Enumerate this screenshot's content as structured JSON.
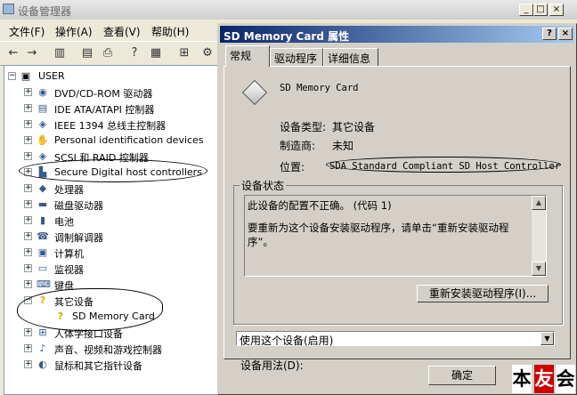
{
  "device_manager": {
    "title": "设备管理器",
    "menu": [
      "文件(F)",
      "操作(A)",
      "查看(V)",
      "帮助(H)"
    ],
    "root": "USER",
    "tree": [
      {
        "label": "DVD/CD-ROM 驱动器",
        "icon": "dvd-drive-icon",
        "glyph": "◉"
      },
      {
        "label": "IDE ATA/ATAPI 控制器",
        "icon": "ide-controller-icon",
        "glyph": "▤"
      },
      {
        "label": "IEEE 1394 总线主控制器",
        "icon": "ieee1394-icon",
        "glyph": "◈"
      },
      {
        "label": "Personal identification devices",
        "icon": "fingerprint-device-icon",
        "glyph": "✋"
      },
      {
        "label": "SCSI 和 RAID 控制器",
        "icon": "scsi-controller-icon",
        "glyph": "◈"
      },
      {
        "label": "Secure Digital host controllers",
        "icon": "sd-host-controller-icon",
        "glyph": "▙"
      },
      {
        "label": "处理器",
        "icon": "processor-icon",
        "glyph": "◆"
      },
      {
        "label": "磁盘驱动器",
        "icon": "disk-drive-icon",
        "glyph": "▬"
      },
      {
        "label": "电池",
        "icon": "battery-icon",
        "glyph": "▮"
      },
      {
        "label": "调制解调器",
        "icon": "modem-icon",
        "glyph": "☎"
      },
      {
        "label": "计算机",
        "icon": "computer-icon",
        "glyph": "▣"
      },
      {
        "label": "监视器",
        "icon": "monitor-icon",
        "glyph": "▭"
      },
      {
        "label": "键盘",
        "icon": "keyboard-icon",
        "glyph": "⌨"
      },
      {
        "label": "其它设备",
        "icon": "other-devices-icon",
        "glyph": "?"
      },
      {
        "label": "SD Memory Card",
        "icon": "warning-device-icon",
        "glyph": "?"
      },
      {
        "label": "人体学接口设备",
        "icon": "hid-icon",
        "glyph": "⊞"
      },
      {
        "label": "声音、视频和游戏控制器",
        "icon": "sound-controller-icon",
        "glyph": "♪"
      },
      {
        "label": "鼠标和其它指针设备",
        "icon": "mouse-icon",
        "glyph": "◐"
      }
    ]
  },
  "dialog": {
    "title": "SD Memory Card 属性",
    "help": "?",
    "close": "×",
    "tabs": [
      "常规",
      "驱动程序",
      "详细信息"
    ],
    "device_name": "SD Memory Card",
    "fields": [
      {
        "label": "设备类型:",
        "value": "其它设备"
      },
      {
        "label": "制造商:",
        "value": "未知"
      },
      {
        "label": "位置:",
        "value": "SDA Standard Compliant SD Host Controller"
      }
    ],
    "status_group": "设备状态",
    "status_line1": "此设备的配置不正确。 (代码 1)",
    "status_line2": "要重新为这个设备安装驱动程序，请单击“重新安装驱动程序”。",
    "reinstall_button": "重新安装驱动程序(I)...",
    "usage_label": "设备用法(D):",
    "usage_value": "使用这个设备(启用)",
    "ok_button": "确定"
  },
  "watermark": [
    "本",
    "友",
    "会"
  ],
  "colors": {
    "title_active": "#0a246a",
    "title_gradient_end": "#a6caf0",
    "window": "#d4d0c8",
    "warning": "#e8c400"
  }
}
